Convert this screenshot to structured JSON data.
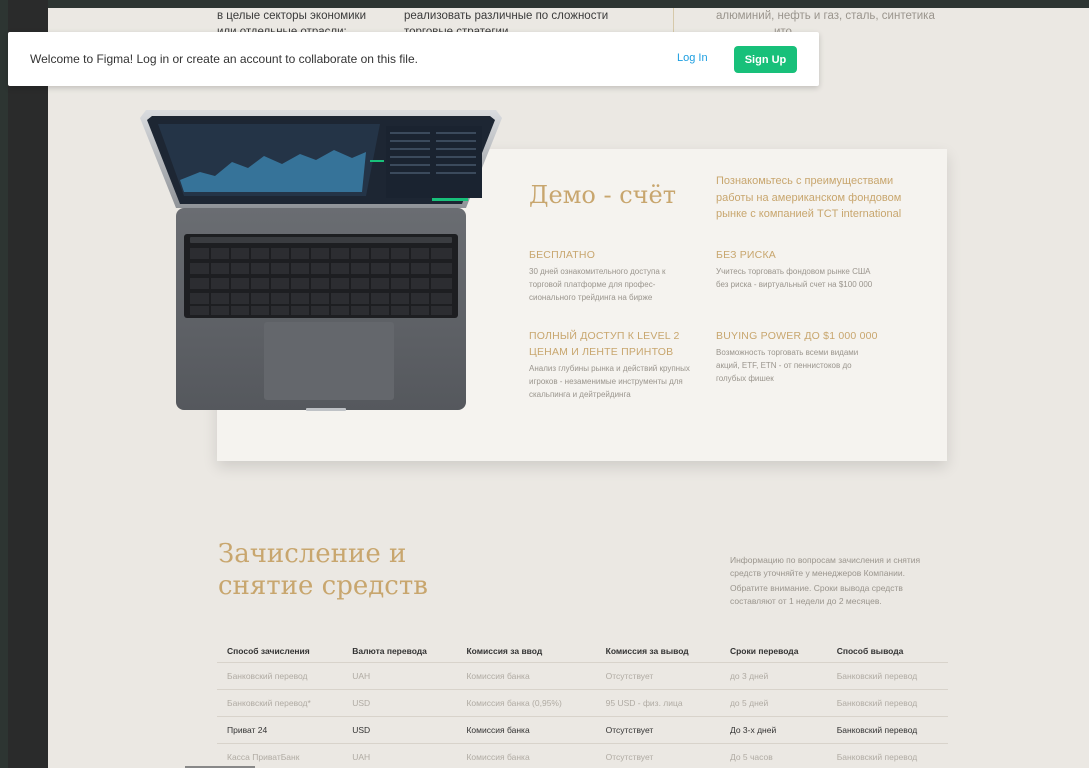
{
  "top": {
    "col1": [
      "в целые секторы экономики",
      "или отдельные отрасли:"
    ],
    "col2": [
      "реализовать различные по сложности",
      "торговые стратегии"
    ],
    "col3": [
      "алюминий, нефть и газ, сталь, синтетика",
      "ито."
    ]
  },
  "banner": {
    "text": "Welcome to Figma! Log in or create an account to collaborate on this file.",
    "login": "Log In",
    "signup": "Sign Up"
  },
  "demo": {
    "title": "Демо - счёт",
    "intro": "Познакомьтесь с преимуществами работы на американском фондовом рынке с компанией TCT international",
    "features": [
      {
        "title": "БЕСПЛАТНО",
        "desc": "30 дней ознакомительного доступа к торговой платформе для профес-сионального трейдинга на бирже"
      },
      {
        "title": "БЕЗ РИСКА",
        "desc": "Учитесь торговать фондовом рынке США без риска - виртуальный счет на $100 000"
      },
      {
        "title": "ПОЛНЫЙ ДОСТУП К LEVEL 2 ЦЕНАМ И ЛЕНТЕ ПРИНТОВ",
        "desc": "Анализ глубины рынка и действий крупных игроков - незаменимые инструменты для скальпинга и дейтрейдинга"
      },
      {
        "title": "BUYING POWER ДО $1 000 000",
        "desc": "Возможность торговать всеми видами акций, ETF, ETN - от пеннистоков до голубых фишек"
      }
    ]
  },
  "section": {
    "title_line1": "Зачисление и",
    "title_line2": "снятие средств",
    "note1": "Информацию по вопросам зачисления и снятия средств уточняйте у менеджеров Компании.",
    "note2": "Обратите внимание. Сроки вывода средств составляют от 1 недели до 2 месяцев."
  },
  "table": {
    "headers": [
      "Способ зачисления",
      "Валюта перевода",
      "Комиссия за ввод",
      "Комиссия за вывод",
      "Сроки перевода",
      "Способ вывода"
    ],
    "rows": [
      [
        "Банковский перевод",
        "UAH",
        "Комиссия банка",
        "Отсутствует",
        "до 3 дней",
        "Банковский перевод"
      ],
      [
        "Банковский перевод*",
        "USD",
        "Комиссия банка (0,95%)",
        "95 USD - физ. лица",
        "до 5 дней",
        "Банковский перевод"
      ],
      [
        "Приват 24",
        "USD",
        "Комиссия банка",
        "Отсутствует",
        "До 3-х дней",
        "Банковский перевод"
      ],
      [
        "Касса ПриватБанк",
        "UAH",
        "Комиссия банка",
        "Отсутствует",
        "До 5 часов",
        "Банковский перевод"
      ]
    ]
  },
  "colors": {
    "accent": "#c8a66e",
    "signup": "#18c07a",
    "link": "#1c9ee0",
    "page_bg": "#ebe8e3"
  }
}
